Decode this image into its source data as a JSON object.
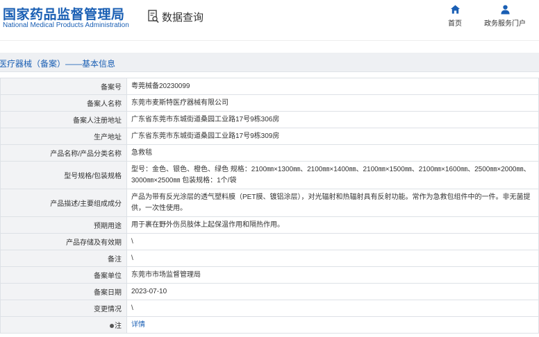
{
  "header": {
    "logo_cn": "国家药品监督管理局",
    "logo_en": "National Medical Products Administration",
    "query_label": "数据查询",
    "nav": [
      {
        "label": "首页",
        "icon": "home-icon"
      },
      {
        "label": "政务服务门户",
        "icon": "person-icon"
      }
    ]
  },
  "section": {
    "title": "医疗器械（备案）——基本信息"
  },
  "rows": [
    {
      "label": "备案号",
      "value": "粤莞械备20230099"
    },
    {
      "label": "备案人名称",
      "value": "东莞市麦斯特医疗器械有限公司"
    },
    {
      "label": "备案人注册地址",
      "value": "广东省东莞市东城街道桑园工业路17号9栋306房"
    },
    {
      "label": "生产地址",
      "value": "广东省东莞市东城街道桑园工业路17号9栋309房"
    },
    {
      "label": "产品名称/产品分类名称",
      "value": "急救毯"
    },
    {
      "label": "型号规格/包装规格",
      "value": "型号：金色、银色、橙色、绿色 规格：2100㎜×1300㎜、2100㎜×1400㎜、2100㎜×1500㎜、2100㎜×1600㎜、2500㎜×2000㎜、3000㎜×2500㎜ 包装规格：1个/袋"
    },
    {
      "label": "产品描述/主要组成成分",
      "value": "产品为带有反光涂层的透气塑料膜（PET膜、镀铝涂层），对光辐射和热辐射具有反射功能。常作为急救包组件中的一件。非无菌提供，一次性使用。"
    },
    {
      "label": "预期用途",
      "value": "用于裹在野外伤员肢体上起保温作用和隔热作用。"
    },
    {
      "label": "产品存储及有效期",
      "value": "\\"
    },
    {
      "label": "备注",
      "value": "\\"
    },
    {
      "label": "备案单位",
      "value": "东莞市市场监督管理局"
    },
    {
      "label": "备案日期",
      "value": "2023-07-10"
    },
    {
      "label": "变更情况",
      "value": "\\"
    },
    {
      "label": "注",
      "value": "详情"
    }
  ],
  "colors": {
    "brand": "#1a5fb4",
    "label_bg": "#f2f3f5",
    "border": "#dde1e6"
  }
}
